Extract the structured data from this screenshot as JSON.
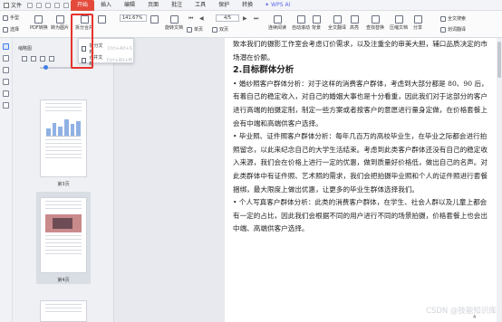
{
  "tabs": {
    "file": "文件",
    "items": [
      "开始",
      "插入",
      "编辑",
      "页面",
      "批注",
      "工具",
      "保护",
      "转换"
    ],
    "wps_ai": "WPS AI"
  },
  "ribbon": {
    "hand": "手型",
    "select": "选择",
    "pdf_to": "PDF转换",
    "pdf_img": "转为图片",
    "pdf_img_sub": "PDF转图片",
    "split": "拆分合并",
    "zoom": "141.67%",
    "page": "4/5",
    "rotate": "旋转文档",
    "single": "单页",
    "double": "双页",
    "continuous": "连续阅读",
    "autoscroll": "自动滚动",
    "bg": "背景",
    "full": "全文翻译",
    "highlight": "高亮",
    "find": "查找替换",
    "search": "全文搜索",
    "compress": "压缩文档",
    "share": "分享",
    "ocr": "划词翻译",
    "annot": "注释"
  },
  "dropdown": [
    {
      "label": "拆分文档",
      "shortcut": "Ctrl+Alt+S"
    },
    {
      "label": "合并文档",
      "shortcut": "Ctrl+Alt+M"
    }
  ],
  "thumbnails": {
    "header": "缩略图",
    "labels": [
      "第3页",
      "第4页"
    ]
  },
  "document": {
    "intro": "致本我们的摄影工作室会考虑订价需求，以及注重全的审美大胆，辅口品质决定的市场潜在价额。",
    "heading": "2.目标群体分析",
    "paragraphs": [
      "• 婚纱照客户群体分析：对于这样的消费客户群体，考虑到大部分都是 80、90 后，有着自己的稳定收入，对自己的婚姻大事也是十分看重，因此我们对于这部分的客户进行高端的拍摄定制，制定一些方案或者按客户的意愿进行量身定做，在价格套餐上会有中端和高端供客户选择。",
      "• 毕业照、证件照客户群体分析：每年几百万的高校毕业生，在毕业之际都会进行拍照留念，以此来纪念自己的大学生活结束。考虑到此类客户群体还没有自己的稳定收入来源，我们会在价格上进行一定的优惠，做到质量好价格低，做出自己的名声。对此类群体中有证件照、艺术照的需求，我们会把拍摄毕业照和个人的证件照进行套餐捆绑，最大限度上做出优惠，让更多的毕业生群体选择我们。",
      "• 个人写真客户群体分析：此类的消费客户群体，在学生、社会人群以及儿童上都会有一定的占比，因此我们会根据不同的用户进行不同的场景拍摄，价格套餐上也会出中端、高端供客户选择。"
    ],
    "page_number": "4"
  },
  "watermark": "CSDN @技能知识库"
}
